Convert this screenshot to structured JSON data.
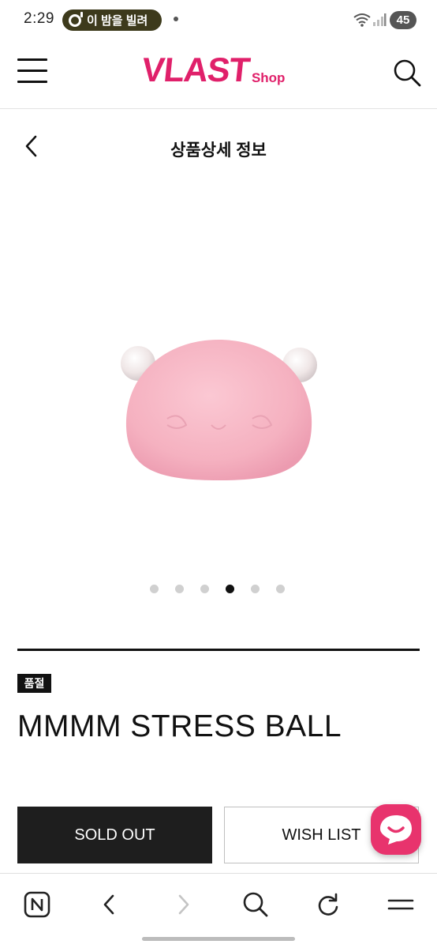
{
  "status_bar": {
    "time": "2:29",
    "media_pill_text": "이 밤을 빌려",
    "battery_level": "45"
  },
  "header": {
    "logo_main": "VLAST",
    "logo_sub": "Shop",
    "brand_color": "#e0206a"
  },
  "title_bar": {
    "title": "상품상세 정보"
  },
  "product": {
    "badge": "품절",
    "name": "MMMM STRESS BALL",
    "image_icon": "pink-bear-stress-ball-image",
    "carousel": {
      "count": 6,
      "active_index": 3
    }
  },
  "actions": {
    "sold_out_label": "SOLD OUT",
    "wish_list_label": "WISH LIST",
    "chat_icon": "chat-bubble-icon",
    "chat_color": "#e8336d"
  },
  "browser_bar": {
    "icons": [
      "naver-n-icon",
      "back-arrow-icon",
      "forward-arrow-icon",
      "search-icon",
      "refresh-icon",
      "menu-icon"
    ]
  }
}
